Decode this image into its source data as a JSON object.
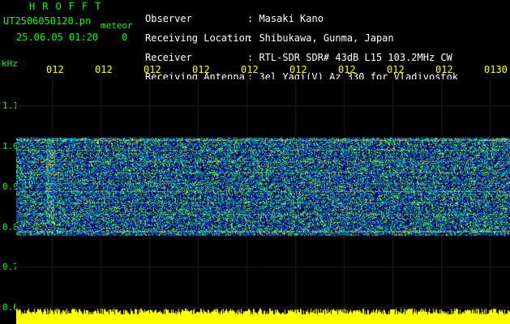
{
  "header": {
    "brand": "HROFFT",
    "filename": "UT2506050120.pn",
    "meteor_label": "meteor",
    "datetime": "25.06.05 01:20",
    "datetime_suffix": "0",
    "info": [
      {
        "label": "Observer",
        "value": "Masaki Kano"
      },
      {
        "label": "Receiving Location",
        "value": "Shibukawa, Gunma, Japan"
      },
      {
        "label": "Receiver",
        "value": "RTL-SDR SDR# 43dB L15 103.2MHz CW"
      },
      {
        "label": "Receiving Antenna",
        "value": "3el Yagi(V) Az 330 for Vladivostok"
      }
    ]
  },
  "axes": {
    "y_unit": "kHz",
    "y_ticks": [
      "1.1",
      "1.0",
      "0.9",
      "0.8",
      "0.7",
      "0.6"
    ],
    "x_ticks": [
      "012",
      "012",
      "012",
      "012",
      "012",
      "012",
      "012",
      "012",
      "012",
      "0130"
    ]
  },
  "colors": {
    "background": "#000000",
    "grid": "#1a1a1a",
    "label_green": "#00ff00",
    "tick_yellow": "#ffff00",
    "floor_yellow": "#ffff00",
    "band_blue": "#0000aa"
  }
}
